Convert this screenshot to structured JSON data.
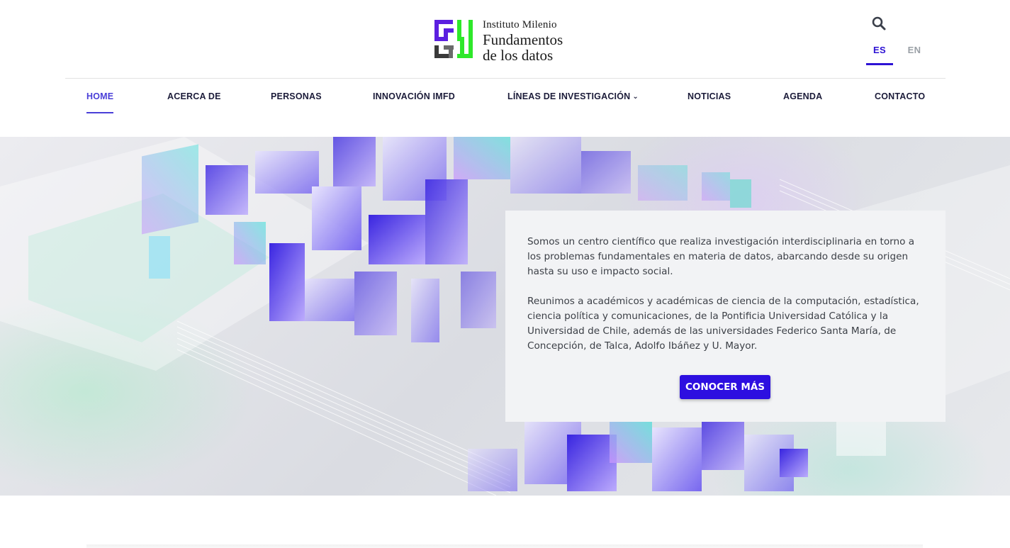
{
  "logo": {
    "line1": "Instituto Milenio",
    "line2": "Fundamentos",
    "line3": "de los datos",
    "colors": {
      "purple": "#5b1fe0",
      "green": "#2ee82a",
      "gray": "#6b6b6b"
    }
  },
  "header": {
    "search_icon": "search-icon",
    "languages": [
      {
        "label": "ES",
        "active": true
      },
      {
        "label": "EN",
        "active": false
      }
    ]
  },
  "nav": {
    "items": [
      {
        "label": "HOME",
        "active": true
      },
      {
        "label": "ACERCA DE"
      },
      {
        "label": "PERSONAS"
      },
      {
        "label": "INNOVACIÓN IMFD"
      },
      {
        "label": "LÍNEAS DE INVESTIGACIÓN",
        "dropdown_icon": "chevron-down-icon"
      },
      {
        "label": "NOTICIAS"
      },
      {
        "label": "AGENDA"
      },
      {
        "label": "CONTACTO"
      }
    ]
  },
  "hero": {
    "paragraph1": "Somos un centro científico que realiza investigación interdisciplinaria en torno a los problemas fundamentales en materia de datos, abarcando desde su origen hasta su uso e impacto social.",
    "paragraph2": "Reunimos a académicos y académicas de ciencia de la computación, estadística, ciencia política y comunicaciones, de la Pontificia Universidad Católica y la Universidad de Chile, además de las universidades Federico Santa María, de Concepción, de Talca, Adolfo Ibáñez y U. Mayor.",
    "cta_label": "CONOCER MÁS"
  },
  "colors": {
    "accent": "#2d0fe0",
    "nav_active": "#4a3fd8",
    "text": "#1c1c3a"
  }
}
